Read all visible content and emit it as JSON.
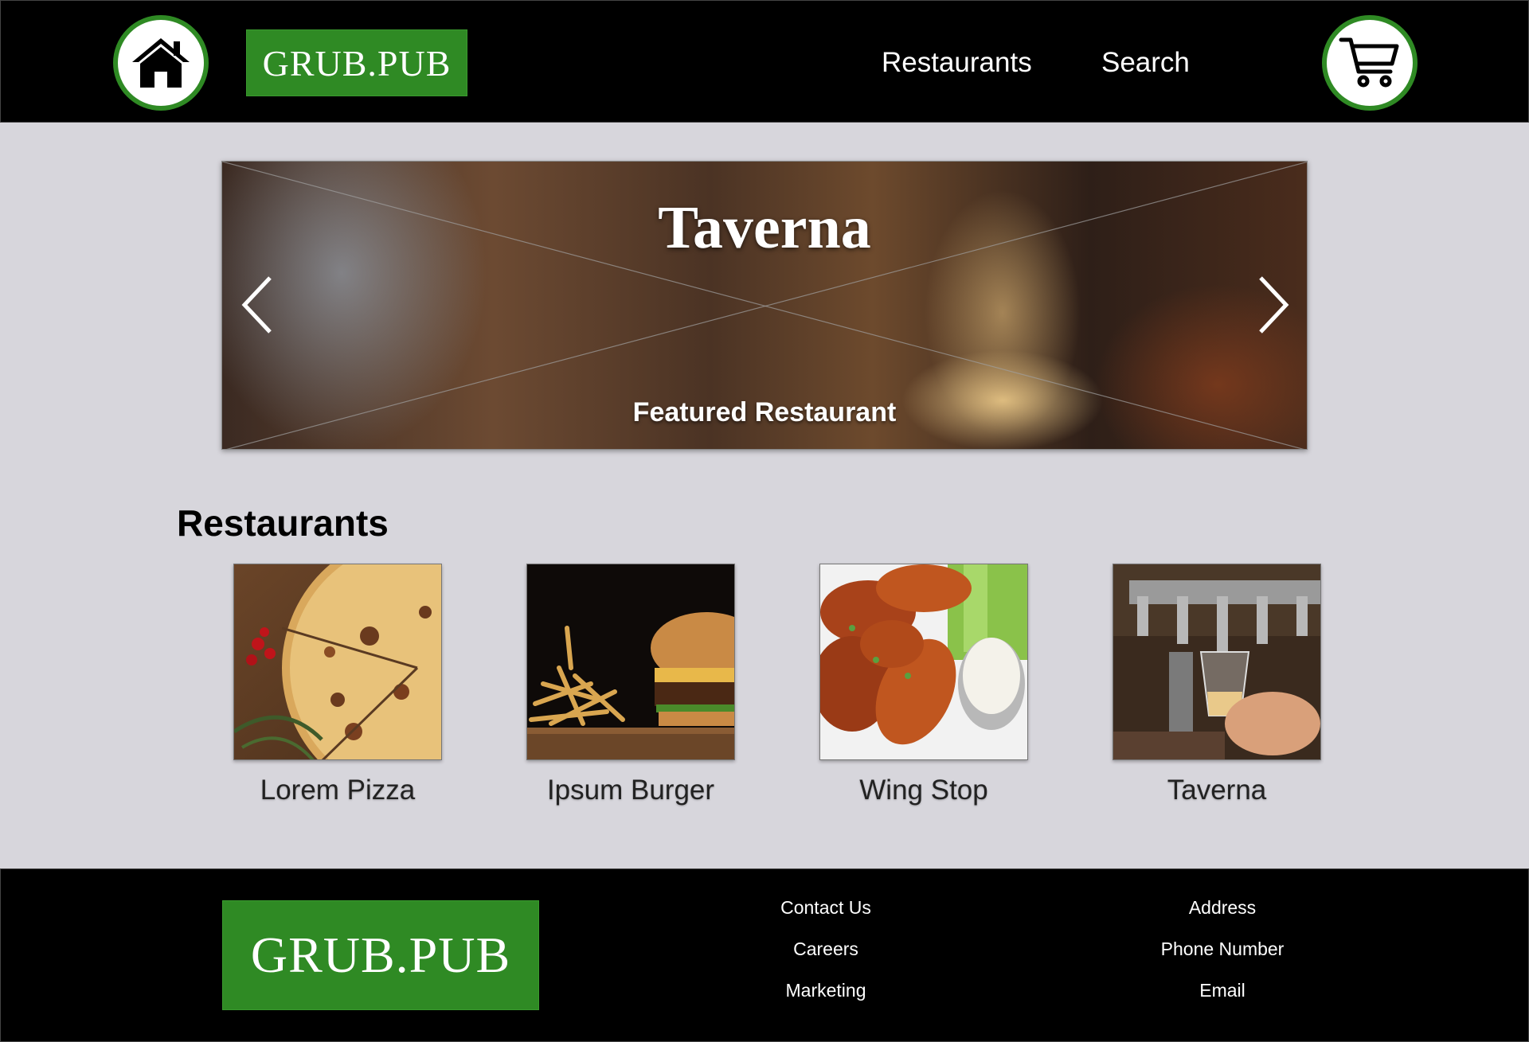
{
  "header": {
    "logo_text": "GRUB.PUB",
    "nav": [
      {
        "label": "Restaurants"
      },
      {
        "label": "Search"
      }
    ],
    "home_icon": "home-icon",
    "cart_icon": "cart-icon"
  },
  "hero": {
    "title": "Taverna",
    "subtitle": "Featured Restaurant",
    "prev_icon": "chevron-left-icon",
    "next_icon": "chevron-right-icon"
  },
  "restaurants": {
    "heading": "Restaurants",
    "items": [
      {
        "name": "Lorem Pizza",
        "image": "pizza"
      },
      {
        "name": "Ipsum Burger",
        "image": "burger"
      },
      {
        "name": "Wing Stop",
        "image": "chicken-wings"
      },
      {
        "name": "Taverna",
        "image": "beer-tap"
      }
    ]
  },
  "footer": {
    "logo_text": "GRUB.PUB",
    "col1": [
      "Contact Us",
      "Careers",
      "Marketing"
    ],
    "col2": [
      "Address",
      "Phone Number",
      "Email"
    ]
  },
  "colors": {
    "brand_green": "#2f8a24",
    "header_bg": "#000000",
    "page_bg": "#d7d6dc"
  }
}
